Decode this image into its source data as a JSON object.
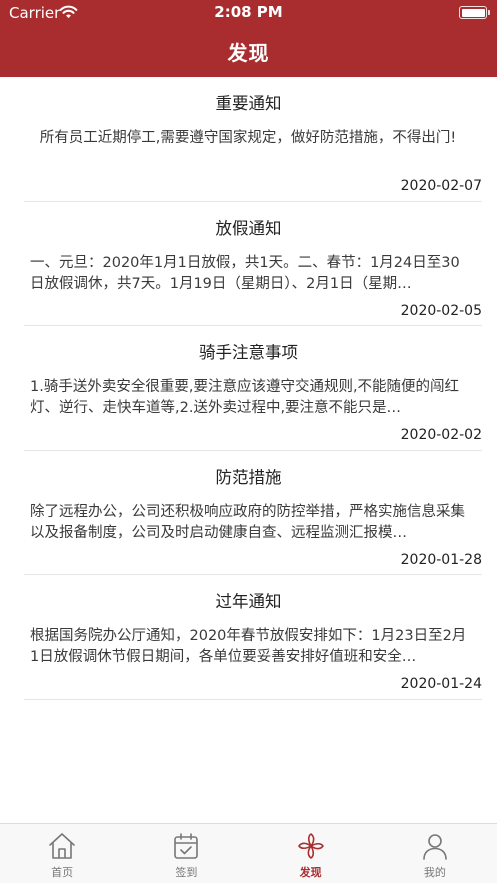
{
  "status_bar": {
    "carrier": "Carrier",
    "time": "2:08 PM"
  },
  "header": {
    "title": "发现"
  },
  "notices": [
    {
      "title": "重要通知",
      "body": "所有员工近期停工,需要遵守国家规定，做好防范措施，不得出门!",
      "date": "2020-02-07"
    },
    {
      "title": "放假通知",
      "body": "一、元旦：2020年1月1日放假，共1天。二、春节：1月24日至30日放假调休，共7天。1月19日（星期日）、2月1日（星期…",
      "date": "2020-02-05"
    },
    {
      "title": "骑手注意事项",
      "body": "1.骑手送外卖安全很重要,要注意应该遵守交通规则,不能随便的闯红灯、逆行、走快车道等,2.送外卖过程中,要注意不能只是…",
      "date": "2020-02-02"
    },
    {
      "title": "防范措施",
      "body": "除了远程办公，公司还积极响应政府的防控举措，严格实施信息采集以及报备制度，公司及时启动健康自查、远程监测汇报模…",
      "date": "2020-01-28"
    },
    {
      "title": "过年通知",
      "body": "根据国务院办公厅通知，2020年春节放假安排如下：1月23日至2月1日放假调休节假日期间，各单位要妥善安排好值班和安全…",
      "date": "2020-01-24"
    }
  ],
  "tabs": [
    {
      "label": "首页",
      "icon": "home-icon"
    },
    {
      "label": "签到",
      "icon": "calendar-check-icon"
    },
    {
      "label": "发现",
      "icon": "pinwheel-icon",
      "active": true
    },
    {
      "label": "我的",
      "icon": "user-icon"
    }
  ],
  "colors": {
    "brand": "#a92d2f",
    "tab_inactive": "#777777"
  }
}
